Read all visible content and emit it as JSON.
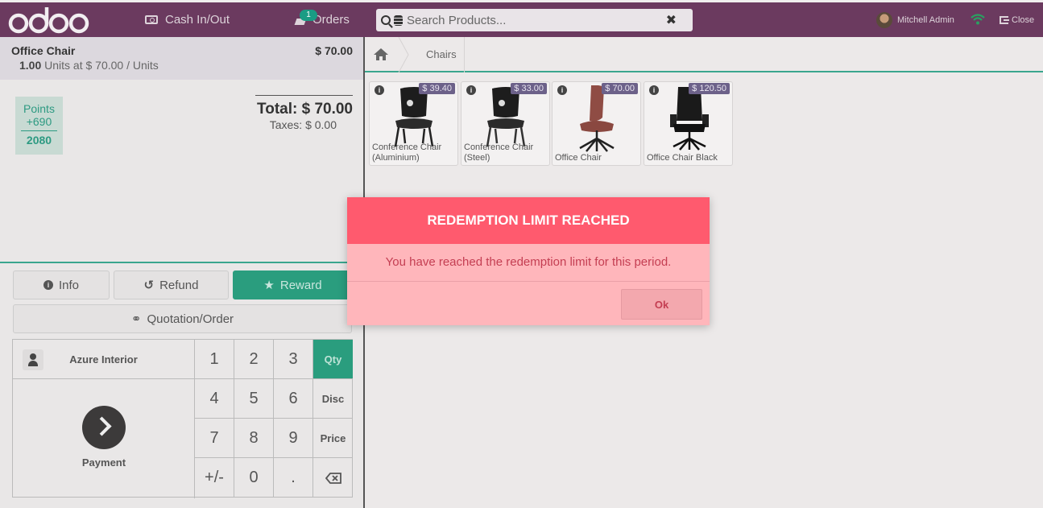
{
  "topbar": {
    "logo_text": "odoo",
    "cash_label": "Cash In/Out",
    "orders_label": "Orders",
    "orders_badge": "1",
    "search_placeholder": "Search Products...",
    "user_name": "Mitchell Admin",
    "close_label": "Close",
    "colors": {
      "bar": "#6b3a5f",
      "accent": "#2a9d7e"
    }
  },
  "order": {
    "line": {
      "product": "Office Chair",
      "price": "$ 70.00",
      "qty": "1.00",
      "detail": "Units at $ 70.00 / Units"
    },
    "points": {
      "label": "Points",
      "won": "+690",
      "balance": "2080"
    },
    "total": "Total: $ 70.00",
    "taxes": "Taxes: $ 0.00"
  },
  "controls": {
    "info": "Info",
    "refund": "Refund",
    "reward": "Reward",
    "quotation": "Quotation/Order"
  },
  "numpad": {
    "customer": "Azure Interior",
    "payment": "Payment",
    "keys": [
      "1",
      "2",
      "3",
      "Qty",
      "4",
      "5",
      "6",
      "Disc",
      "7",
      "8",
      "9",
      "Price",
      "+/-",
      "0",
      "."
    ],
    "active_mode": "Qty"
  },
  "breadcrumb": {
    "category": "Chairs"
  },
  "products": [
    {
      "name": "Conference Chair (Aluminium)",
      "price": "$ 39.40"
    },
    {
      "name": "Conference Chair (Steel)",
      "price": "$ 33.00"
    },
    {
      "name": "Office Chair",
      "price": "$ 70.00"
    },
    {
      "name": "Office Chair Black",
      "price": "$ 120.50"
    }
  ],
  "dialog": {
    "title": "REDEMPTION LIMIT REACHED",
    "message": "You have reached the redemption limit for this period.",
    "ok": "Ok",
    "colors": {
      "header": "#ff5a6e",
      "body": "#ffb6bb",
      "text": "#c43e52"
    }
  }
}
